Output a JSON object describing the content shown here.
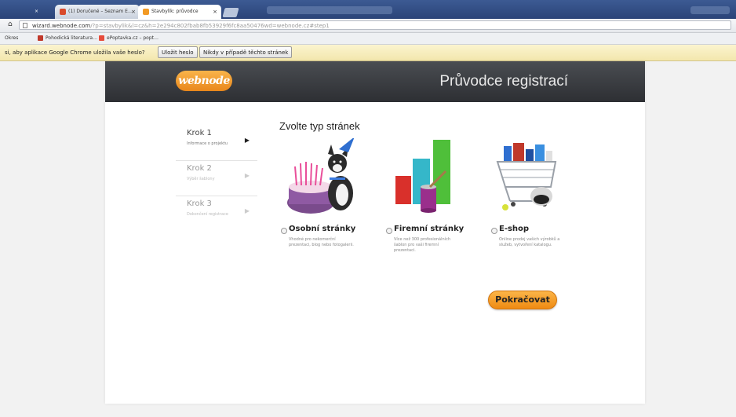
{
  "browser": {
    "tabs": [
      {
        "label": "×"
      },
      {
        "label": "(1) Doručené – Seznam E…"
      },
      {
        "label": "Stavbylík: průvodce"
      }
    ],
    "url": {
      "host": "wizard.webnode.com",
      "path": "/?p=stavbylik&l=cz&h=2e294c802fbab8fb53929f6fc8aa50476wd=webnode.cz#step1"
    },
    "bookmarks": [
      {
        "label": "Okres"
      },
      {
        "label": "Pohodická literatura…"
      },
      {
        "label": "ePoptavka.cz – popt…"
      }
    ],
    "infobar": {
      "text": "si, aby aplikace Google Chrome uložila vaše heslo?",
      "save_label": "Uložit heslo",
      "never_label": "Nikdy v případě těchto stránek"
    }
  },
  "header": {
    "logo": "webnode",
    "title": "Průvodce registrací"
  },
  "steps": [
    {
      "title": "Krok 1",
      "subtitle": "Informace o projektu",
      "active": true
    },
    {
      "title": "Krok 2",
      "subtitle": "Výběr šablony",
      "active": false
    },
    {
      "title": "Krok 3",
      "subtitle": "Dokončení registrace",
      "active": false
    }
  ],
  "section_title": "Zvolte typ stránek",
  "options": [
    {
      "label": "Osobní stránky",
      "desc": "Vhodné pro nekomerční prezentaci, blog nebo fotogalerii."
    },
    {
      "label": "Firemní stránky",
      "desc": "Více než 300 profesionálních šablon pro vaši firemní prezentaci."
    },
    {
      "label": "E-shop",
      "desc": "Online prodej vašich výrobků a služeb, vytvoření katalogu."
    }
  ],
  "continue_label": "Pokračovat",
  "colors": {
    "accent": "#f0901a",
    "header_bg": "#3a3c40"
  }
}
